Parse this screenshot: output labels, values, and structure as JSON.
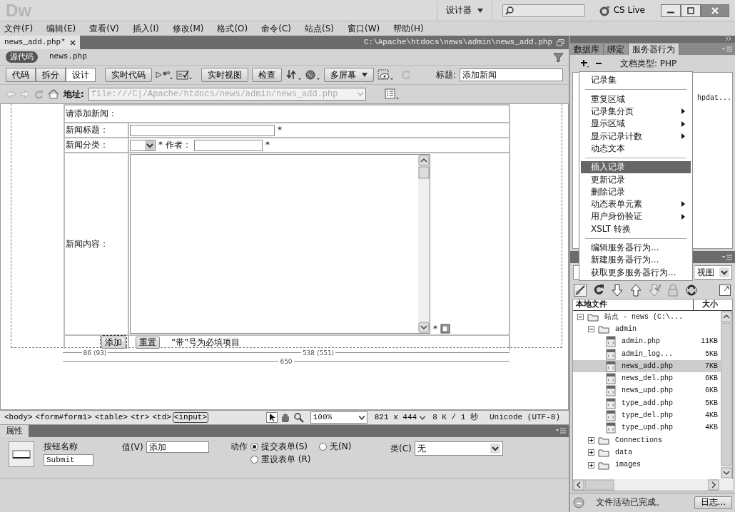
{
  "app": {
    "logo": "Dw",
    "workspace": "设计器",
    "cs_live": "CS Live"
  },
  "menu": [
    "文件(F)",
    "编辑(E)",
    "查看(V)",
    "插入(I)",
    "修改(M)",
    "格式(O)",
    "命令(C)",
    "站点(S)",
    "窗口(W)",
    "帮助(H)"
  ],
  "document": {
    "tab": {
      "label": "news_add.php*",
      "selected": true
    },
    "path": "C:\\Apache\\htdocs\\news\\admin\\news_add.php",
    "related_files": [
      {
        "label": "源代码",
        "selected": true
      },
      {
        "label": "news.php",
        "selected": false
      }
    ],
    "views": [
      {
        "label": "代码",
        "selected": false
      },
      {
        "label": "拆分",
        "selected": false
      },
      {
        "label": "设计",
        "selected": true
      }
    ],
    "live_code": "实时代码",
    "live_view": "实时视图",
    "inspect": "检查",
    "multiscreen": "多屏幕",
    "title_label": "标题:",
    "title_value": "添加新闻",
    "address_label": "地址:",
    "address_value": "file:///C|/Apache/htdocs/news/admin/news_add.php"
  },
  "form": {
    "heading": "请添加新闻：",
    "title_label": "新闻标题：",
    "category_label": "新闻分类：",
    "author_label": "作者：",
    "content_label": "新闻内容：",
    "required_mark": "*",
    "submit": "添加",
    "reset": "重置",
    "note": "“带”号为必填项目",
    "rulers": [
      "86 (93)",
      "538 (551)",
      "650"
    ]
  },
  "tag_selector": [
    {
      "label": "<body>",
      "selected": false
    },
    {
      "label": "<form#form1>",
      "selected": false
    },
    {
      "label": "<table>",
      "selected": false
    },
    {
      "label": "<tr>",
      "selected": false
    },
    {
      "label": "<td>",
      "selected": false
    },
    {
      "label": "<input>",
      "selected": true
    }
  ],
  "status": {
    "zoom": "100%",
    "size": "821 x 444",
    "download": "8 K / 1 秒",
    "encoding": "Unicode (UTF-8)"
  },
  "properties": {
    "title": "属性",
    "name_label": "按钮名称",
    "name_value": "Submit",
    "value_label": "值(V)",
    "value": "添加",
    "action_label": "动作",
    "actions": [
      {
        "label": "提交表单(S)",
        "selected": true
      },
      {
        "label": "无(N)",
        "selected": false
      },
      {
        "label": "重设表单 (R)",
        "selected": false
      }
    ],
    "class_label": "类(C)",
    "class_value": "无"
  },
  "server_panel": {
    "tabs": [
      {
        "label": "数据库",
        "selected": false
      },
      {
        "label": "绑定",
        "selected": false
      },
      {
        "label": "服务器行为",
        "selected": true
      }
    ],
    "doc_type": "文档类型: PHP",
    "list_item": "hpdat..."
  },
  "context_menu": [
    {
      "kind": "item",
      "label": "记录集",
      "submenu": false,
      "selected": false
    },
    {
      "kind": "separator"
    },
    {
      "kind": "item",
      "label": "重复区域",
      "submenu": false,
      "selected": false
    },
    {
      "kind": "item",
      "label": "记录集分页",
      "submenu": true,
      "selected": false
    },
    {
      "kind": "item",
      "label": "显示区域",
      "submenu": true,
      "selected": false
    },
    {
      "kind": "item",
      "label": "显示记录计数",
      "submenu": true,
      "selected": false
    },
    {
      "kind": "item",
      "label": "动态文本",
      "submenu": false,
      "selected": false
    },
    {
      "kind": "separator"
    },
    {
      "kind": "item",
      "label": "插入记录",
      "submenu": false,
      "selected": true
    },
    {
      "kind": "item",
      "label": "更新记录",
      "submenu": false,
      "selected": false
    },
    {
      "kind": "item",
      "label": "删除记录",
      "submenu": false,
      "selected": false
    },
    {
      "kind": "item",
      "label": "动态表单元素",
      "submenu": true,
      "selected": false
    },
    {
      "kind": "item",
      "label": "用户身份验证",
      "submenu": true,
      "selected": false
    },
    {
      "kind": "item",
      "label": "XSLT 转换",
      "submenu": false,
      "selected": false
    },
    {
      "kind": "separator"
    },
    {
      "kind": "item",
      "label": "编辑服务器行为...",
      "submenu": false,
      "selected": false
    },
    {
      "kind": "item",
      "label": "新建服务器行为...",
      "submenu": false,
      "selected": false
    },
    {
      "kind": "item",
      "label": "获取更多服务器行为...",
      "submenu": false,
      "selected": false
    }
  ],
  "files_panel": {
    "view_select": "视图",
    "columns": [
      "本地文件",
      "大小"
    ],
    "tree": [
      {
        "name": "站点 - news (C:\\...",
        "kind": "site",
        "expanded": true,
        "children": [
          {
            "name": "admin",
            "kind": "folder",
            "expanded": true,
            "children": [
              {
                "name": "admin.php",
                "kind": "file",
                "size": "11KB",
                "selected": false
              },
              {
                "name": "admin_log...",
                "kind": "file",
                "size": "5KB",
                "selected": false
              },
              {
                "name": "news_add.php",
                "kind": "file",
                "size": "7KB",
                "selected": true
              },
              {
                "name": "news_del.php",
                "kind": "file",
                "size": "6KB",
                "selected": false
              },
              {
                "name": "news_upd.php",
                "kind": "file",
                "size": "6KB",
                "selected": false
              },
              {
                "name": "type_add.php",
                "kind": "file",
                "size": "5KB",
                "selected": false
              },
              {
                "name": "type_del.php",
                "kind": "file",
                "size": "4KB",
                "selected": false
              },
              {
                "name": "type_upd.php",
                "kind": "file",
                "size": "4KB",
                "selected": false
              }
            ]
          },
          {
            "name": "Connections",
            "kind": "folder",
            "expanded": false
          },
          {
            "name": "data",
            "kind": "folder",
            "expanded": false
          },
          {
            "name": "images",
            "kind": "folder",
            "expanded": false
          }
        ]
      }
    ],
    "status": "文件活动已完成。",
    "log_button": "日志..."
  }
}
